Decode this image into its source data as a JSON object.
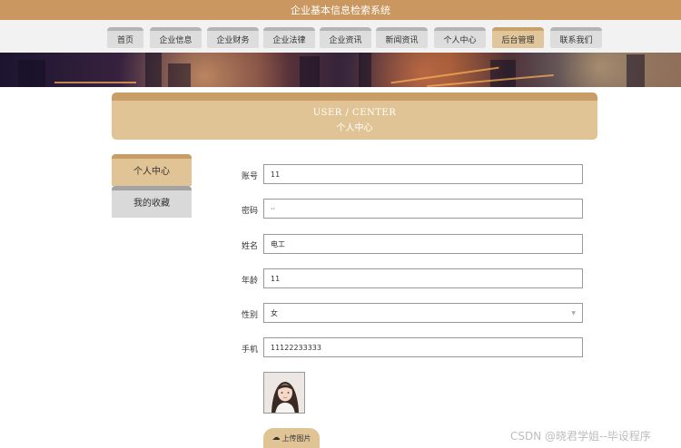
{
  "header": {
    "title": "企业基本信息检索系统"
  },
  "nav": {
    "items": [
      {
        "label": "首页",
        "active": false
      },
      {
        "label": "企业信息",
        "active": false
      },
      {
        "label": "企业财务",
        "active": false
      },
      {
        "label": "企业法律",
        "active": false
      },
      {
        "label": "企业资讯",
        "active": false
      },
      {
        "label": "新闻资讯",
        "active": false
      },
      {
        "label": "个人中心",
        "active": false
      },
      {
        "label": "后台管理",
        "active": true
      },
      {
        "label": "联系我们",
        "active": false
      }
    ]
  },
  "panel": {
    "title_en": "USER / CENTER",
    "title_cn": "个人中心"
  },
  "sidebar": {
    "items": [
      {
        "label": "个人中心",
        "active": true
      },
      {
        "label": "我的收藏",
        "active": false
      }
    ]
  },
  "form": {
    "account": {
      "label": "账号",
      "value": "11"
    },
    "password": {
      "label": "密码",
      "value": "··"
    },
    "name": {
      "label": "姓名",
      "value": "电工"
    },
    "age": {
      "label": "年龄",
      "value": "11"
    },
    "gender": {
      "label": "性别",
      "value": "女"
    },
    "phone": {
      "label": "手机",
      "value": "11122233333"
    }
  },
  "avatar": {
    "label": ""
  },
  "upload": {
    "label": "上传图片",
    "icon": "cloud-upload-icon"
  },
  "watermark": {
    "text": "CSDN @晓君学姐--毕设程序"
  },
  "colors": {
    "accent": "#c9975f",
    "accent_light": "#e0c495",
    "nav_gray": "#dddddd"
  }
}
